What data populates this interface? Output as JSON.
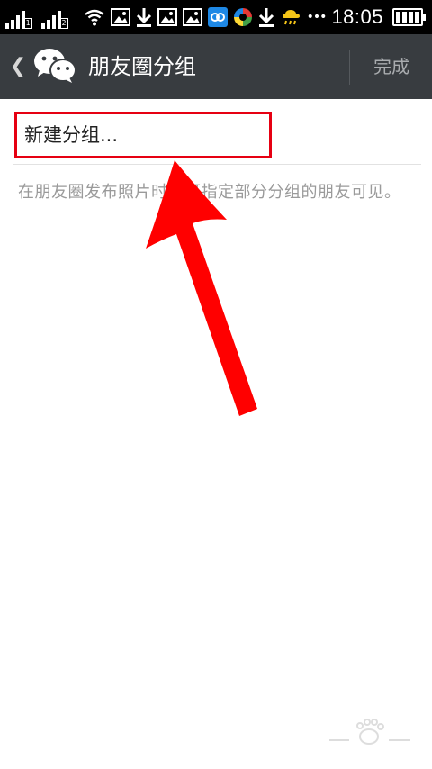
{
  "status_bar": {
    "sim1_tag": "1",
    "sim2_tag": "2",
    "overflow_dots": "•••",
    "clock": "18:05",
    "icons": [
      "signal-icon",
      "signal-icon",
      "wifi-icon",
      "image-icon",
      "download-icon",
      "image-icon",
      "image-icon",
      "qq-icon",
      "app-icon",
      "download-icon",
      "weather-icon",
      "more-icon",
      "battery-icon"
    ]
  },
  "title_bar": {
    "back_glyph": "❮",
    "title": "朋友圈分组",
    "done_label": "完成",
    "logo_icon": "wechat-icon"
  },
  "content": {
    "new_group_label": "新建分组...",
    "hint_text": "在朋友圈发布照片时，可指定部分分组的朋友可见。"
  },
  "colors": {
    "status_bar_bg": "#000000",
    "title_bar_bg": "#383c40",
    "highlight_red": "#e60012",
    "hint_gray": "#9a9a9a"
  }
}
